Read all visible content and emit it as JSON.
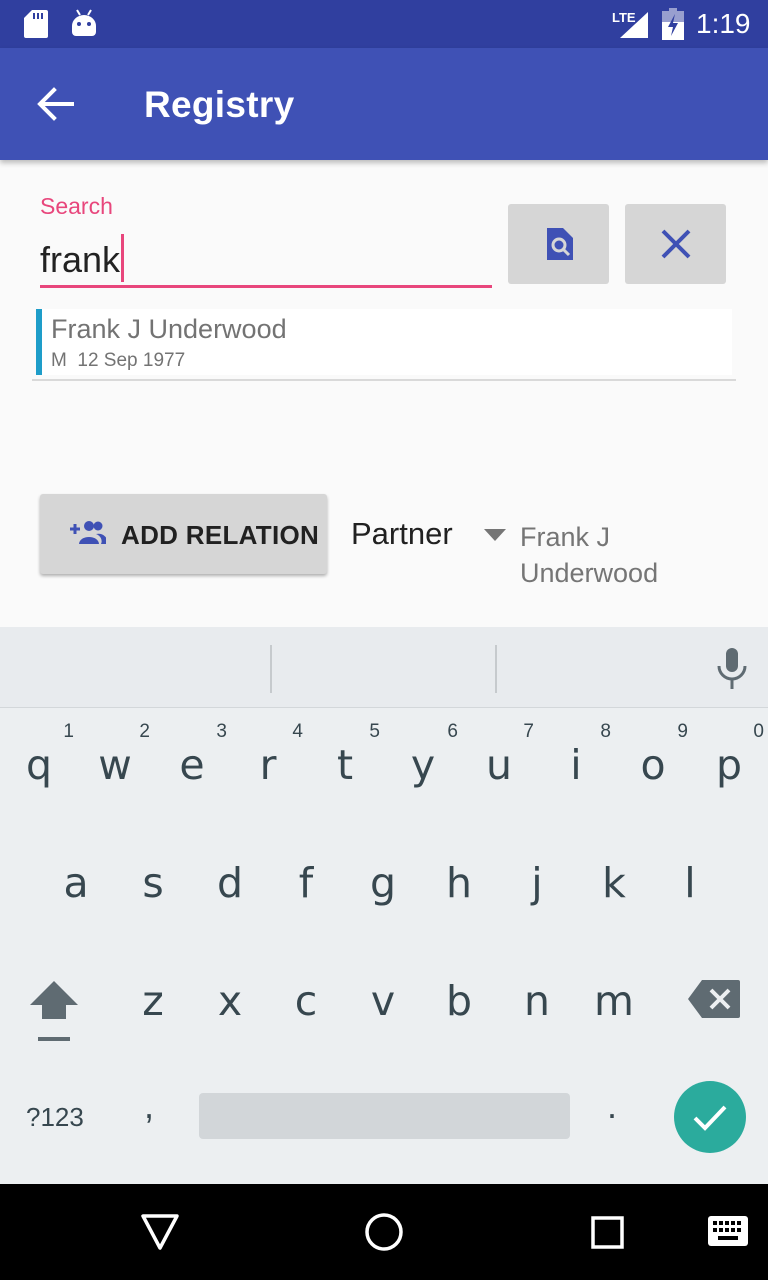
{
  "status_bar": {
    "network": "LTE",
    "time": "1:19",
    "icons": [
      "sd-card-icon",
      "android-debug-icon",
      "lte-signal-icon",
      "battery-charging-icon"
    ]
  },
  "app_bar": {
    "title": "Registry",
    "back_icon": "arrow-back-icon"
  },
  "search": {
    "label": "Search",
    "value": "frank",
    "search_icon": "find-in-page-icon",
    "clear_icon": "close-icon"
  },
  "results": [
    {
      "name": "Frank J Underwood",
      "sex": "M",
      "date": "12 Sep 1977"
    }
  ],
  "relation": {
    "add_label": "ADD RELATION",
    "add_icon": "group-add-icon",
    "type": "Partner",
    "target": "Frank J Underwood"
  },
  "keyboard": {
    "row1": [
      "q",
      "w",
      "e",
      "r",
      "t",
      "y",
      "u",
      "i",
      "o",
      "p"
    ],
    "row1_nums": [
      "1",
      "2",
      "3",
      "4",
      "5",
      "6",
      "7",
      "8",
      "9",
      "0"
    ],
    "row2": [
      "a",
      "s",
      "d",
      "f",
      "g",
      "h",
      "j",
      "k",
      "l"
    ],
    "row3": [
      "z",
      "x",
      "c",
      "v",
      "b",
      "n",
      "m"
    ],
    "symbols": "?123",
    "comma": ",",
    "period": "."
  },
  "colors": {
    "status_bar": "#303f9f",
    "app_bar": "#3f51b5",
    "accent": "#e8467c",
    "result_marker": "#1e9dc9",
    "enter_key": "#2bab9d"
  }
}
